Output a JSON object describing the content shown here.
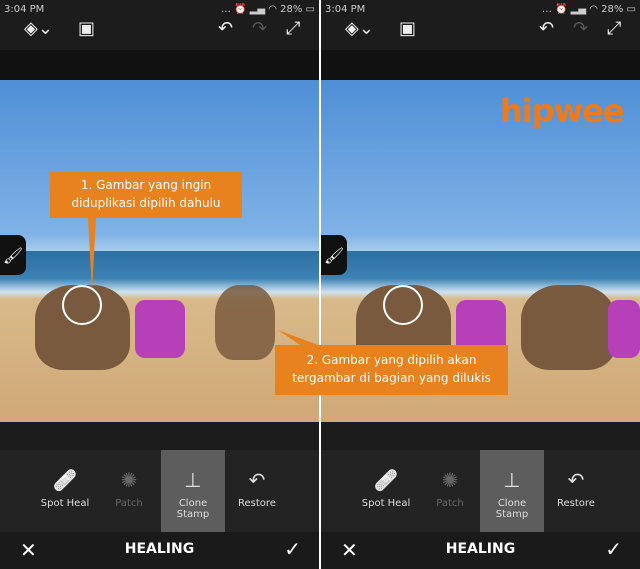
{
  "status": {
    "time": "3:04 PM",
    "battery": "28%"
  },
  "tools": [
    {
      "label": "Spot Heal",
      "icon": "bandage-icon",
      "state": "normal"
    },
    {
      "label": "Patch",
      "icon": "patch-icon",
      "state": "disabled"
    },
    {
      "label": "Clone Stamp",
      "icon": "stamp-icon",
      "state": "selected"
    },
    {
      "label": "Restore",
      "icon": "restore-icon",
      "state": "normal"
    }
  ],
  "bottom": {
    "title": "HEALING"
  },
  "callouts": {
    "first": "1. Gambar yang ingin diduplikasi dipilih dahulu",
    "second": "2. Gambar yang dipilih akan tergambar di bagian yang dilukis"
  },
  "logo": "hipwee",
  "colors": {
    "accent": "#e8821e",
    "logo": "#f07a1a"
  }
}
